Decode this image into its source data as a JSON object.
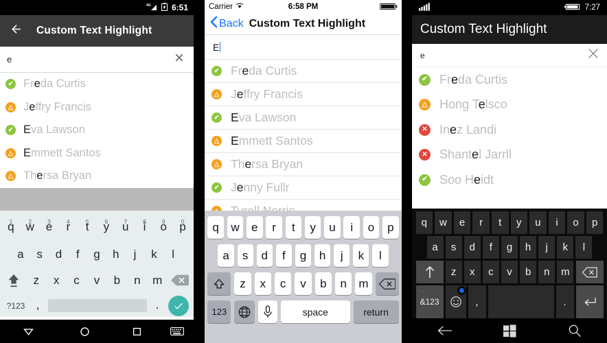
{
  "android": {
    "status": {
      "time": "6:51",
      "signal_icon": "signal-4g-icon",
      "battery_icon": "battery-icon"
    },
    "appbar": {
      "back_icon": "back-arrow-icon",
      "title": "Custom Text Highlight"
    },
    "search": {
      "value": "e",
      "clear_icon": "close-icon"
    },
    "list": [
      {
        "status": "ok",
        "prefix": "Fr",
        "match": "e",
        "suffix": "da Curtis"
      },
      {
        "status": "warn",
        "prefix": "J",
        "match": "e",
        "suffix": "ffry Francis"
      },
      {
        "status": "ok",
        "prefix": "",
        "match": "E",
        "suffix": "va Lawson"
      },
      {
        "status": "warn",
        "prefix": "",
        "match": "E",
        "suffix": "mmett Santos"
      },
      {
        "status": "warn",
        "prefix": "Th",
        "match": "e",
        "suffix": "rsa Bryan"
      }
    ],
    "keyboard": {
      "row1": [
        "q",
        "w",
        "e",
        "r",
        "t",
        "y",
        "u",
        "i",
        "o",
        "p"
      ],
      "row1_hints": [
        "1",
        "2",
        "3",
        "4",
        "5",
        "6",
        "7",
        "8",
        "9",
        "0"
      ],
      "row2": [
        "a",
        "s",
        "d",
        "f",
        "g",
        "h",
        "j",
        "k",
        "l"
      ],
      "row3": [
        "z",
        "x",
        "c",
        "v",
        "b",
        "n",
        "m"
      ],
      "shift_icon": "shift-icon",
      "delete_icon": "backspace-icon",
      "numbers_label": "?123",
      "comma_label": ",",
      "period_label": ".",
      "enter_icon": "check-icon"
    },
    "nav": {
      "back_icon": "keyboard-hide-triangle-icon",
      "home_icon": "home-circle-icon",
      "recents_icon": "recents-square-icon",
      "keyboard_icon": "keyboard-icon"
    }
  },
  "ios": {
    "status": {
      "carrier": "Carrier",
      "wifi_icon": "wifi-icon",
      "time": "6:58 PM",
      "battery_icon": "battery-icon"
    },
    "navbar": {
      "back_icon": "chevron-left-icon",
      "back_label": "Back",
      "title": "Custom Text Highlight"
    },
    "search": {
      "value": "E"
    },
    "list": [
      {
        "status": "ok",
        "prefix": "Fr",
        "match": "e",
        "suffix": "da Curtis"
      },
      {
        "status": "warn",
        "prefix": "J",
        "match": "e",
        "suffix": "ffry Francis"
      },
      {
        "status": "ok",
        "prefix": "",
        "match": "E",
        "suffix": "va Lawson"
      },
      {
        "status": "warn",
        "prefix": "",
        "match": "E",
        "suffix": "mmett Santos"
      },
      {
        "status": "warn",
        "prefix": "Th",
        "match": "e",
        "suffix": "rsa Bryan"
      },
      {
        "status": "ok",
        "prefix": "J",
        "match": "e",
        "suffix": "nny Fullr"
      },
      {
        "status": "warn",
        "prefix": "T",
        "match": "",
        "suffix": "yrell Norris"
      }
    ],
    "keyboard": {
      "row1": [
        "q",
        "w",
        "e",
        "r",
        "t",
        "y",
        "u",
        "i",
        "o",
        "p"
      ],
      "row2": [
        "a",
        "s",
        "d",
        "f",
        "g",
        "h",
        "j",
        "k",
        "l"
      ],
      "row3": [
        "z",
        "x",
        "c",
        "v",
        "b",
        "n",
        "m"
      ],
      "shift_icon": "shift-icon",
      "delete_icon": "backspace-icon",
      "numbers_label": "123",
      "globe_icon": "globe-icon",
      "mic_icon": "microphone-icon",
      "space_label": "space",
      "return_label": "return"
    }
  },
  "windows": {
    "status": {
      "signal_icon": "signal-bars-icon",
      "battery_icon": "battery-icon",
      "time": "7:27"
    },
    "appbar": {
      "title": "Custom Text Highlight"
    },
    "search": {
      "value": "e",
      "clear_icon": "close-icon"
    },
    "list": [
      {
        "status": "ok",
        "prefix": "Fr",
        "match": "e",
        "suffix": "da Curtis"
      },
      {
        "status": "warn",
        "prefix": "Hong T",
        "match": "e",
        "suffix": "lsco"
      },
      {
        "status": "err",
        "prefix": "In",
        "match": "e",
        "suffix": "z Landi"
      },
      {
        "status": "err",
        "prefix": "Shant",
        "match": "e",
        "suffix": "l Jarrll"
      },
      {
        "status": "ok",
        "prefix": "Soo H",
        "match": "e",
        "suffix": "idt"
      }
    ],
    "keyboard": {
      "row1": [
        "q",
        "w",
        "e",
        "r",
        "t",
        "y",
        "u",
        "i",
        "o",
        "p"
      ],
      "row2": [
        "a",
        "s",
        "d",
        "f",
        "g",
        "h",
        "j",
        "k",
        "l"
      ],
      "row3": [
        "z",
        "x",
        "c",
        "v",
        "b",
        "n",
        "m"
      ],
      "shift_icon": "shift-up-arrow-icon",
      "delete_icon": "backspace-icon",
      "symbols_label": "&123",
      "symbols_dots": "···",
      "emoji_icon": "emoji-smiley-icon",
      "comma_label": ",",
      "period_label": ".",
      "return_icon": "enter-icon"
    },
    "nav": {
      "back_icon": "back-arrow-icon",
      "start_icon": "windows-logo-icon",
      "search_icon": "search-icon"
    }
  },
  "status_icons": {
    "ok": "✔",
    "warn": "△",
    "err": "✕"
  },
  "colors": {
    "ok": "#8DC540",
    "warn": "#F5A01E",
    "err": "#E3473B",
    "android_accent": "#3FB5AC",
    "ios_blue": "#1177FF",
    "windows_cursor": "#1565E8"
  }
}
